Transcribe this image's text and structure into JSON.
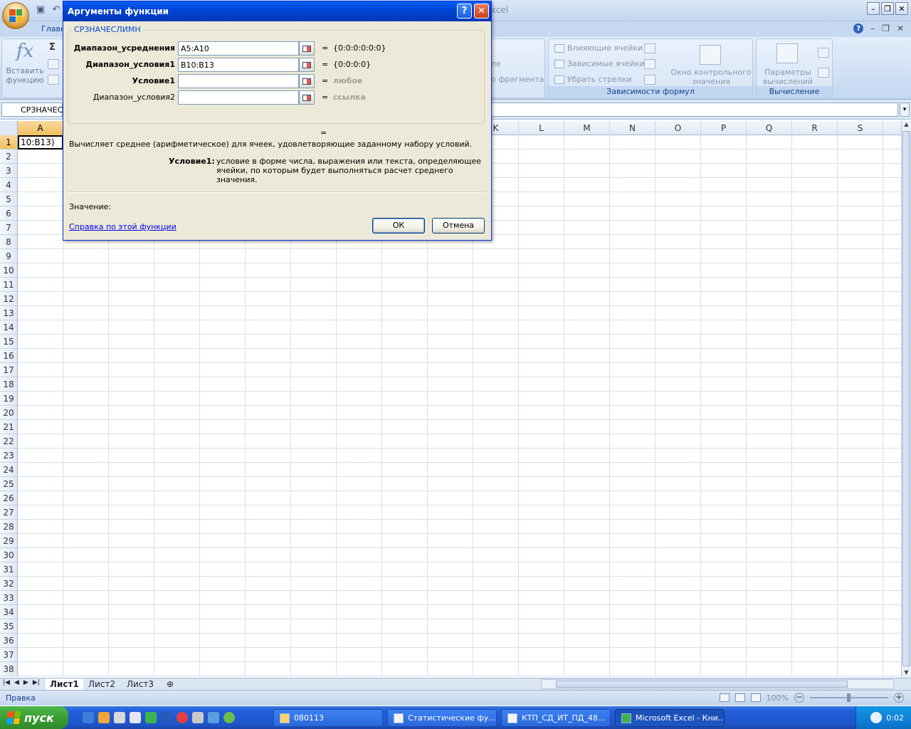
{
  "window": {
    "title_partial": "xcel"
  },
  "ribbon": {
    "tab_home": "Главн",
    "insert_function": "Вставить функцию",
    "sum_symbol": "Σ",
    "partial_text_1": "ле",
    "partial_text_2": "о фрагмента",
    "dependencies": {
      "trace_precedents": "Влияющие ячейки",
      "trace_dependents": "Зависимые ячейки",
      "remove_arrows": "Убрать стрелки",
      "group_label": "Зависимости формул"
    },
    "watch_window": "Окно контрольного значения",
    "calc_options": "Параметры вычислений",
    "calc_group_label": "Вычисление"
  },
  "formula_bar": {
    "name_box": "СРЗНАЧЕСЛ"
  },
  "grid": {
    "columns_left": [
      "A"
    ],
    "columns_right": [
      "K",
      "L",
      "M",
      "N",
      "O",
      "P",
      "Q",
      "R",
      "S"
    ],
    "rows": [
      "1",
      "2",
      "3",
      "4",
      "5",
      "6",
      "7",
      "8",
      "9",
      "10",
      "11",
      "12",
      "13",
      "14",
      "15",
      "16",
      "17",
      "18",
      "19",
      "20",
      "21",
      "22",
      "23",
      "24",
      "25",
      "26",
      "27",
      "28",
      "29",
      "30",
      "31",
      "32",
      "33",
      "34",
      "35",
      "36",
      "37",
      "38"
    ],
    "active_cell_text": "10:B13)"
  },
  "sheets": {
    "tabs": [
      "Лист1",
      "Лист2",
      "Лист3"
    ],
    "active": "Лист1"
  },
  "status": {
    "mode": "Правка",
    "zoom": "100%"
  },
  "taskbar": {
    "start": "пуск",
    "tasks": [
      {
        "label": "080113"
      },
      {
        "label": "Статистические фу..."
      },
      {
        "label": "КТП_СД_ИТ_ПД_48..."
      },
      {
        "label": "Microsoft Excel - Кни..."
      }
    ],
    "clock": "0:02"
  },
  "dialog": {
    "title": "Аргументы функции",
    "function_name": "СРЗНАЧЕСЛИМН",
    "args": [
      {
        "label": "Диапазон_усреднения",
        "value": "A5:A10",
        "result": "{0:0:0:0:0:0}",
        "bold": true,
        "hint": false
      },
      {
        "label": "Диапазон_условия1",
        "value": "B10:B13",
        "result": "{0:0:0:0}",
        "bold": true,
        "hint": false
      },
      {
        "label": "Условие1",
        "value": "",
        "result": "любое",
        "bold": true,
        "hint": true
      },
      {
        "label": "Диапазон_условия2",
        "value": "",
        "result": "ссылка",
        "bold": false,
        "hint": true
      }
    ],
    "equals": "=",
    "description": "Вычисляет среднее (арифметическое) для ячеек, удовлетворяющие заданному набору условий.",
    "arg_help_name": "Условие1:",
    "arg_help_text": "условие в форме числа, выражения или текста, определяющее ячейки, по которым будет выполняться расчет среднего значения.",
    "value_label": "Значение:",
    "help_link": "Справка по этой функции",
    "ok": "ОК",
    "cancel": "Отмена",
    "help_btn": "?",
    "close_btn": "✕"
  }
}
